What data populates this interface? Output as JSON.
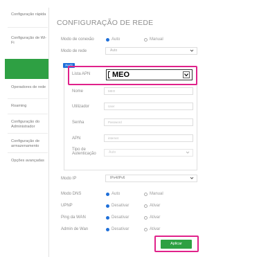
{
  "sidebar": {
    "items": [
      {
        "label": "Configuração rápida"
      },
      {
        "label": "Configuração de Wi-Fi"
      },
      {
        "label": "Operadores de rede"
      },
      {
        "label": "Roaming"
      },
      {
        "label": "Configuração do Administrador"
      },
      {
        "label": "Configuração de armazenamento"
      },
      {
        "label": "Opções avançadas"
      }
    ]
  },
  "page": {
    "title": "CONFIGURAÇÃO DE REDE"
  },
  "form": {
    "connection_mode": {
      "label": "Modo de conexão",
      "opt1": "Auto",
      "opt2": "Manual"
    },
    "network_mode": {
      "label": "Modo de rede",
      "value": "Auto"
    },
    "profile_tag": "Perfil",
    "apn_list": {
      "label": "Lista APN",
      "value": "MEO"
    },
    "name": {
      "label": "Nome",
      "value": "MEO"
    },
    "user": {
      "label": "Utilizador",
      "value": "User"
    },
    "password": {
      "label": "Senha",
      "value": "Password"
    },
    "apn": {
      "label": "APN",
      "value": "internet"
    },
    "auth_type": {
      "label": "Tipo de Autenticação",
      "value": "Auto"
    },
    "ip_mode": {
      "label": "Modo IP",
      "value": "IPv4/IPv6"
    },
    "dns_mode": {
      "label": "Modo DNS",
      "opt1": "Auto",
      "opt2": "Manual"
    },
    "upnp": {
      "label": "UPNP",
      "opt1": "Desativar",
      "opt2": "Ativar"
    },
    "ping_wan": {
      "label": "Ping da WAN",
      "opt1": "Desativar",
      "opt2": "Ativar"
    },
    "admin_wan": {
      "label": "Admin de Wan",
      "opt1": "Desativar",
      "opt2": "Ativar"
    },
    "apply_label": "Aplicar"
  },
  "colors": {
    "accent_green": "#2ea043",
    "accent_blue": "#1e6fd9",
    "highlight_pink": "#e0218a"
  }
}
